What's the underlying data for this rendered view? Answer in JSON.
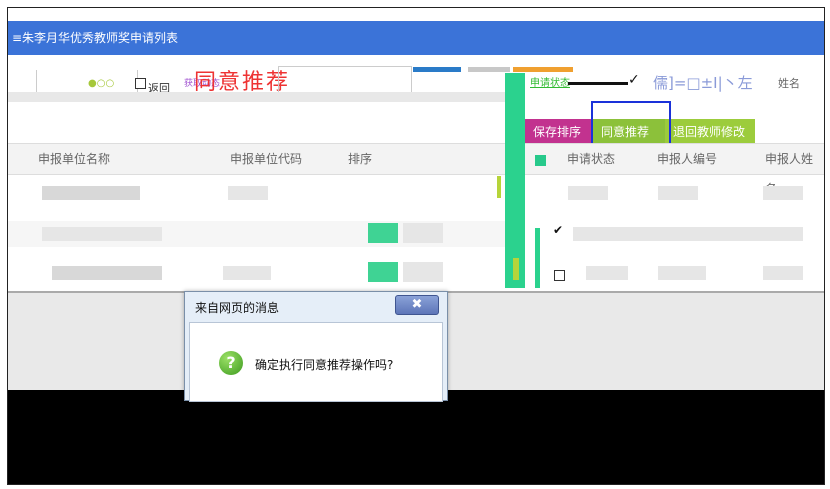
{
  "header": {
    "title": "≡朱李月华优秀教师奖申请列表"
  },
  "toolbar": {
    "return_label": "返回",
    "big_red_text": "同意推荐",
    "purple_text": "获取动态",
    "status_select_value": "申请状态",
    "name_label": "姓名"
  },
  "actions": {
    "save_sort": "保存排序",
    "agree_recommend": "同意推荐",
    "return_modify": "退回教师修改"
  },
  "table": {
    "left_headers": [
      "申报单位名称",
      "申报单位代码",
      "排序"
    ],
    "right_headers": [
      "申请状态",
      "申报人编号",
      "申报人姓名"
    ]
  },
  "dialog": {
    "title": "来自网页的消息",
    "message": "确定执行同意推荐操作吗?",
    "close_symbol": "✖"
  },
  "colors": {
    "title_bar": "#3b73d8",
    "save_button": "#c2328f",
    "agree_button": "#8cc13a",
    "focus_outline": "#1a31d9"
  }
}
